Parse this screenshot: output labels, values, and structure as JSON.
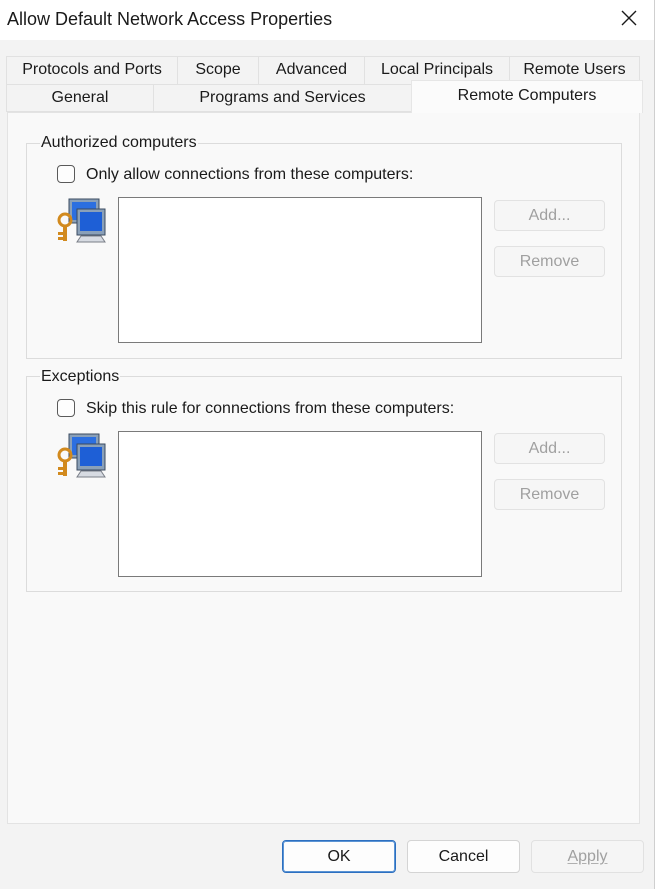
{
  "window": {
    "title": "Allow Default Network Access Properties"
  },
  "tabs": {
    "row1": [
      "Protocols and Ports",
      "Scope",
      "Advanced",
      "Local Principals",
      "Remote Users"
    ],
    "row2": [
      "General",
      "Programs and Services",
      "Remote Computers"
    ],
    "active": "Remote Computers"
  },
  "authorized": {
    "label": "Authorized computers",
    "checkbox_label": "Only allow connections from these computers:",
    "checked": false,
    "add_label": "Add...",
    "remove_label": "Remove",
    "items": []
  },
  "exceptions": {
    "label": "Exceptions",
    "checkbox_label": "Skip this rule for connections from these computers:",
    "checked": false,
    "add_label": "Add...",
    "remove_label": "Remove",
    "items": []
  },
  "footer": {
    "ok_label": "OK",
    "cancel_label": "Cancel",
    "apply_label": "Apply"
  },
  "icons": {
    "close": "close-icon",
    "computers": "computers-key-icon"
  },
  "colors": {
    "accent": "#2c6fc0",
    "disabled_text": "#a0a0a0",
    "panel": "#f9f9f9"
  }
}
